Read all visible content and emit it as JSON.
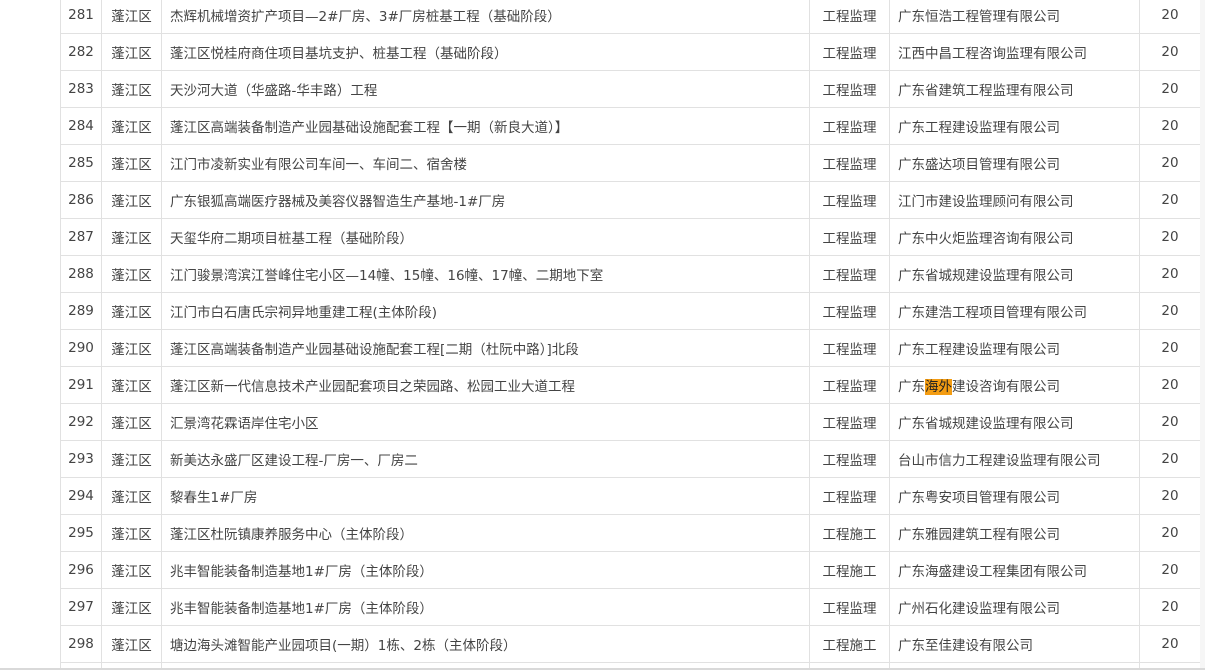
{
  "rows": [
    {
      "no": "281",
      "region": "蓬江区",
      "project": "杰辉机械增资扩产项目—2#厂房、3#厂房桩基工程（基础阶段）",
      "type": "工程监理",
      "company": "广东恒浩工程管理有限公司",
      "score": "20"
    },
    {
      "no": "282",
      "region": "蓬江区",
      "project": "蓬江区悦桂府商住项目基坑支护、桩基工程（基础阶段）",
      "type": "工程监理",
      "company": "江西中昌工程咨询监理有限公司",
      "score": "20"
    },
    {
      "no": "283",
      "region": "蓬江区",
      "project": "天沙河大道（华盛路-华丰路）工程",
      "type": "工程监理",
      "company": "广东省建筑工程监理有限公司",
      "score": "20"
    },
    {
      "no": "284",
      "region": "蓬江区",
      "project": "蓬江区高端装备制造产业园基础设施配套工程【一期（新良大道）】",
      "type": "工程监理",
      "company": "广东工程建设监理有限公司",
      "score": "20"
    },
    {
      "no": "285",
      "region": "蓬江区",
      "project": "江门市凌新实业有限公司车间一、车间二、宿舍楼",
      "type": "工程监理",
      "company": "广东盛达项目管理有限公司",
      "score": "20"
    },
    {
      "no": "286",
      "region": "蓬江区",
      "project": "广东银狐高端医疗器械及美容仪器智造生产基地-1#厂房",
      "type": "工程监理",
      "company": "江门市建设监理顾问有限公司",
      "score": "20"
    },
    {
      "no": "287",
      "region": "蓬江区",
      "project": "天玺华府二期项目桩基工程（基础阶段）",
      "type": "工程监理",
      "company": "广东中火炬监理咨询有限公司",
      "score": "20"
    },
    {
      "no": "288",
      "region": "蓬江区",
      "project": "江门骏景湾滨江誉峰住宅小区—14幢、15幢、16幢、17幢、二期地下室",
      "type": "工程监理",
      "company": "广东省城规建设监理有限公司",
      "score": "20"
    },
    {
      "no": "289",
      "region": "蓬江区",
      "project": "江门市白石唐氏宗祠异地重建工程(主体阶段)",
      "type": "工程监理",
      "company": "广东建浩工程项目管理有限公司",
      "score": "20"
    },
    {
      "no": "290",
      "region": "蓬江区",
      "project": "蓬江区高端装备制造产业园基础设施配套工程[二期（杜阮中路）]北段",
      "type": "工程监理",
      "company": "广东工程建设监理有限公司",
      "score": "20"
    },
    {
      "no": "291",
      "region": "蓬江区",
      "project": "蓬江区新一代信息技术产业园配套项目之荣园路、松园工业大道工程",
      "type": "工程监理",
      "company_pre": "广东",
      "company_hl": "海外",
      "company_post": "建设咨询有限公司",
      "score": "20"
    },
    {
      "no": "292",
      "region": "蓬江区",
      "project": "汇景湾花霖语岸住宅小区",
      "type": "工程监理",
      "company": "广东省城规建设监理有限公司",
      "score": "20"
    },
    {
      "no": "293",
      "region": "蓬江区",
      "project": "新美达永盛厂区建设工程-厂房一、厂房二",
      "type": "工程监理",
      "company": "台山市信力工程建设监理有限公司",
      "score": "20"
    },
    {
      "no": "294",
      "region": "蓬江区",
      "project": "黎春生1#厂房",
      "type": "工程监理",
      "company": "广东粤安项目管理有限公司",
      "score": "20"
    },
    {
      "no": "295",
      "region": "蓬江区",
      "project": "蓬江区杜阮镇康养服务中心（主体阶段）",
      "type": "工程施工",
      "company": "广东雅园建筑工程有限公司",
      "score": "20"
    },
    {
      "no": "296",
      "region": "蓬江区",
      "project": "兆丰智能装备制造基地1#厂房（主体阶段）",
      "type": "工程施工",
      "company": "广东海盛建设工程集团有限公司",
      "score": "20"
    },
    {
      "no": "297",
      "region": "蓬江区",
      "project": "兆丰智能装备制造基地1#厂房（主体阶段）",
      "type": "工程监理",
      "company": "广州石化建设监理有限公司",
      "score": "20"
    },
    {
      "no": "298",
      "region": "蓬江区",
      "project": "塘边海头滩智能产业园项目(一期）1栋、2栋（主体阶段）",
      "type": "工程施工",
      "company": "广东至佳建设有限公司",
      "score": "20"
    }
  ],
  "colors": {
    "highlight": "#f39c12",
    "border": "#e1e1e1",
    "text": "#444444"
  }
}
